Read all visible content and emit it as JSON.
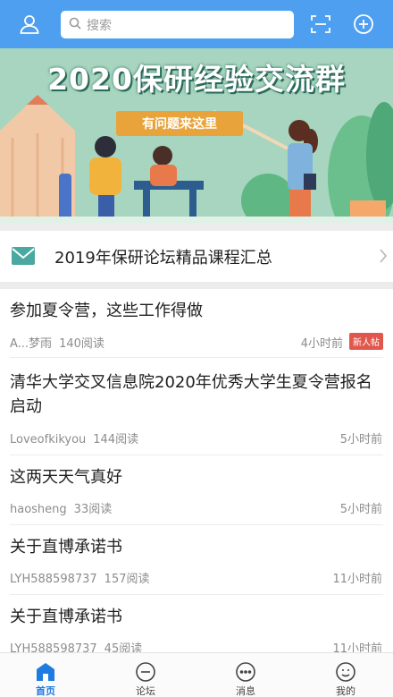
{
  "header": {
    "user_icon": "user-icon",
    "search_placeholder": "搜索",
    "scan_icon": "scan-icon",
    "add_icon": "plus-circle-icon",
    "bg_color": "#4e9ff0"
  },
  "banner": {
    "title": "2020保研经验交流群",
    "subtitle": "有问题来这里"
  },
  "pinned": {
    "icon": "mail-icon",
    "label": "2019年保研论坛精品课程汇总",
    "chevron": "chevron-right-icon"
  },
  "posts": [
    {
      "title": "参加夏令营，这些工作得做",
      "author": "A...梦雨",
      "reads": "140阅读",
      "time": "4小时前",
      "badge": "新人帖"
    },
    {
      "title": "清华大学交叉信息院2020年优秀大学生夏令营报名启动",
      "author": "Loveofkikyou",
      "reads": "144阅读",
      "time": "5小时前"
    },
    {
      "title": "这两天天气真好",
      "author": "haosheng",
      "reads": "33阅读",
      "time": "5小时前"
    },
    {
      "title": "关于直博承诺书",
      "author": "LYH588598737",
      "reads": "157阅读",
      "time": "11小时前"
    },
    {
      "title": "关于直博承诺书",
      "author": "LYH588598737",
      "reads": "45阅读",
      "time": "11小时前"
    }
  ],
  "tabbar": {
    "tabs": [
      {
        "label": "首页",
        "icon": "home-icon",
        "active": true
      },
      {
        "label": "论坛",
        "icon": "forum-icon",
        "active": false
      },
      {
        "label": "消息",
        "icon": "message-icon",
        "active": false
      },
      {
        "label": "我的",
        "icon": "profile-icon",
        "active": false
      }
    ],
    "active_color": "#1e7be0"
  }
}
